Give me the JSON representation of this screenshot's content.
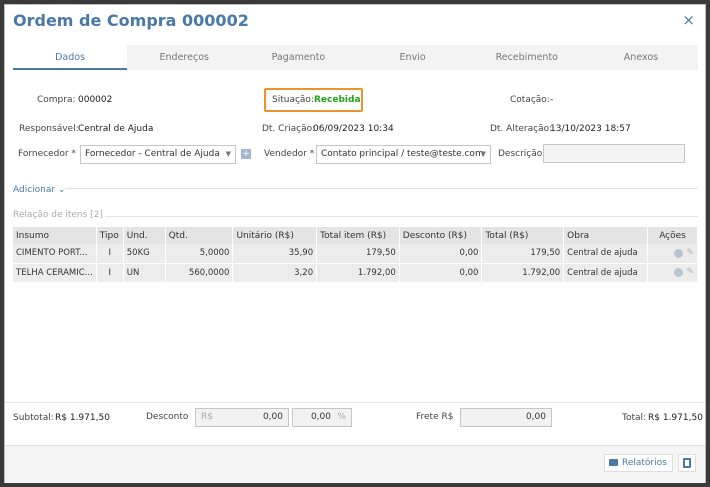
{
  "window": {
    "title": "Ordem de Compra 000002",
    "close_icon": "×"
  },
  "tabs": [
    "Dados",
    "Endereços",
    "Pagamento",
    "Envio",
    "Recebimento",
    "Anexos"
  ],
  "header": {
    "compra_label": "Compra:",
    "compra_value": "000002",
    "situacao_label": "Situação:",
    "situacao_value": "Recebida",
    "cotacao_label": "Cotação:",
    "cotacao_value": "-",
    "responsavel_label": "Responsável:",
    "responsavel_value": "Central de Ajuda",
    "criacao_label": "Dt. Criação:",
    "criacao_value": "06/09/2023 10:34",
    "alteracao_label": "Dt. Alteração:",
    "alteracao_value": "13/10/2023 18:57",
    "fornecedor_label": "Fornecedor *",
    "fornecedor_value": "Fornecedor - Central de Ajuda",
    "vendedor_label": "Vendedor *",
    "vendedor_value": "Contato principal / teste@teste.com",
    "descricao_label": "Descrição",
    "descricao_value": ""
  },
  "adicionar": "Adicionar",
  "items_section": "Relação de itens [2]",
  "table": {
    "columns": [
      "Insumo",
      "Tipo",
      "Und.",
      "Qtd.",
      "Unitário (R$)",
      "Total item (R$)",
      "Desconto (R$)",
      "Total (R$)",
      "Obra",
      "Ações"
    ],
    "rows": [
      [
        "CIMENTO PORT...",
        "I",
        "50KG",
        "5,0000",
        "35,90",
        "179,50",
        "0,00",
        "179,50",
        "Central de ajuda"
      ],
      [
        "TELHA CERAMIC...",
        "I",
        "UN",
        "560,0000",
        "3,20",
        "1.792,00",
        "0,00",
        "1.792,00",
        "Central de ajuda"
      ]
    ]
  },
  "footer": {
    "subtotal_label": "Subtotal:",
    "subtotal_value": "R$ 1.971,50",
    "desconto_label": "Desconto",
    "desconto_prefix": "R$",
    "desconto_value": "0,00",
    "desconto_pct_value": "0,00",
    "desconto_pct_suffix": "%",
    "frete_label": "Frete R$",
    "frete_value": "0,00",
    "total_label": "Total:",
    "total_value": "R$ 1.971,50"
  },
  "actions": {
    "relatorios": "Relatórios"
  },
  "colors": {
    "accent": "#4a79a7",
    "status_green": "#22a31d",
    "highlight": "#e8952c"
  }
}
